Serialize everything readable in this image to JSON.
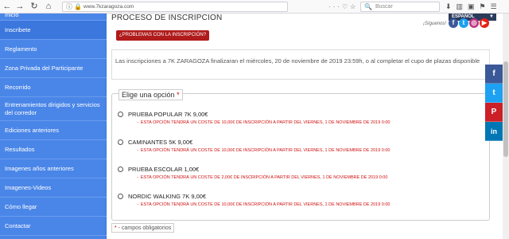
{
  "browser": {
    "url": "www.7kzaragoza.com",
    "search_placeholder": "Buscar",
    "back_icon": "back-arrow-icon",
    "forward_icon": "forward-arrow-icon",
    "reload_icon": "reload-icon",
    "home_icon": "home-icon"
  },
  "sidebar": {
    "items": [
      {
        "label": "Inicio"
      },
      {
        "label": "Inscribete"
      },
      {
        "label": "Reglamento"
      },
      {
        "label": "Zona Privada del Participante"
      },
      {
        "label": "Recorrido"
      },
      {
        "label": "Entrenamientos dirigidos y servicios del corredor"
      },
      {
        "label": "Ediciones anteriores"
      },
      {
        "label": "Resultados"
      },
      {
        "label": "Imagenes años anteriores"
      },
      {
        "label": "Imagenes-Videos"
      },
      {
        "label": "Cómo llegar"
      },
      {
        "label": "Contactar"
      }
    ],
    "active_index": 1
  },
  "header": {
    "title": "PROCESO DE INSCRIPCION",
    "language": "ESPAÑOL",
    "follow_label": "¡Síguenos!"
  },
  "main": {
    "problems_button": "¿PROBLEMAS CON LA INSCRIPCIÓN?",
    "info_text": "Las inscripciones a 7K ZARAGOZA finalizaran el miércoles, 20 de noviembre de 2019 23:59h, o al completar el cupo de plazas disponible",
    "options_legend": "Elige una opción",
    "options": [
      {
        "label": "PRUEBA POPULAR 7K  9,00€",
        "note": "ESTA OPCIÓN TENDRÁ UN COSTE DE 10,00€ DE INSCRIPCIÓN A PARTIR DEL VIERNES, 1 DE NOVIEMBRE DE 2019 0:00"
      },
      {
        "label": "CAMINANTES 5K  9,00€",
        "note": "ESTA OPCIÓN TENDRÁ UN COSTE DE 10,00€ DE INSCRIPCIÓN A PARTIR DEL VIERNES, 1 DE NOVIEMBRE DE 2019 0:00"
      },
      {
        "label": "PRUEBA ESCOLAR  1,00€",
        "note": "ESTA OPCIÓN TENDRÁ UN COSTE DE 2,00€ DE INSCRIPCIÓN A PARTIR DEL VIERNES, 1 DE NOVIEMBRE DE 2019 0:00"
      },
      {
        "label": "NORDIC WALKING 7K  9,00€",
        "note": "ESTA OPCIÓN TENDRÁ UN COSTE DE 10,00€ DE INSCRIPCIÓN A PARTIR DEL VIERNES, 1 DE NOVIEMBRE DE 2019 0:00"
      }
    ],
    "required_note": "- campos obligatorios"
  },
  "share": {
    "buttons": [
      {
        "glyph": "f",
        "color": "#3b5998",
        "icon": "facebook-icon"
      },
      {
        "glyph": "t",
        "color": "#1da1f2",
        "icon": "twitter-icon"
      },
      {
        "glyph": "P",
        "color": "#cb2027",
        "icon": "pinterest-icon"
      },
      {
        "glyph": "in",
        "color": "#0077b5",
        "icon": "linkedin-icon"
      }
    ]
  },
  "colors": {
    "sidebar_bg": "#4a86e8",
    "accent_red": "#b01b1b",
    "note_red": "#d01010"
  }
}
